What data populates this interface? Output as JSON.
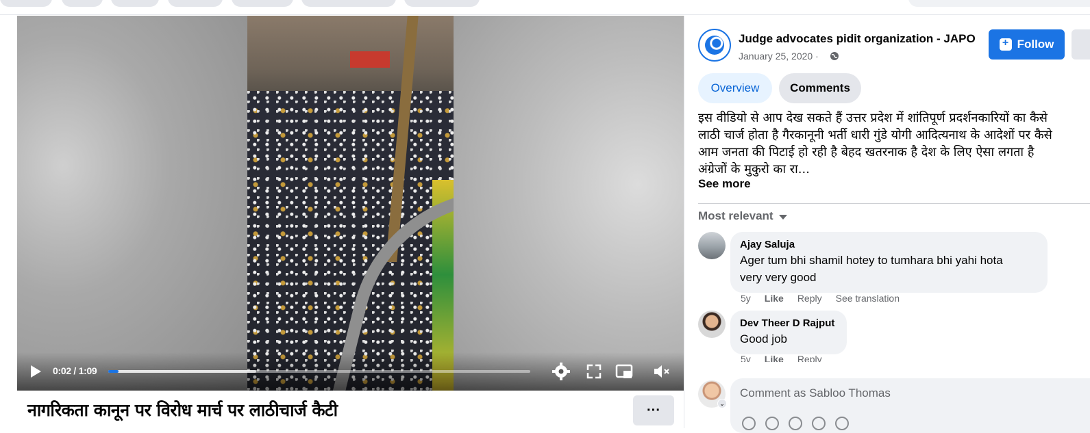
{
  "video": {
    "current_time": "0:02",
    "duration": "1:09",
    "time_display": "0:02 / 1:09",
    "progress_fraction": 0.004,
    "title": "नागरिकता कानून पर विरोध मार्च पर लाठीचार्ज कैटी"
  },
  "post": {
    "page_name": "Judge advocates pidit organization - JAPO",
    "date": "January 25, 2020 ·",
    "follow_label": "Follow",
    "tabs": [
      {
        "label": "Overview",
        "active": true
      },
      {
        "label": "Comments",
        "active": false
      }
    ],
    "description_lines": [
      "इस वीडियो से आप देख सकते हैं उत्तर प्रदेश में शांतिपूर्ण प्रदर्शनकारियों का कैसे",
      "लाठी चार्ज होता है गैरकानूनी भर्ती धारी गुंडे योगी आदित्यनाथ के आदेशों पर कैसे",
      "आम जनता की पिटाई हो रही है बेहद खतरनाक है देश के लिए ऐसा लगता है",
      "अंग्रेजों के मुकुरो का रा..."
    ],
    "see_more": "See more"
  },
  "comments_section": {
    "sort_label": "Most relevant",
    "comments": [
      {
        "author": "Ajay Saluja",
        "text_lines": [
          "Ager tum bhi shamil hotey to tumhara bhi yahi hota",
          "very very good"
        ],
        "age": "5y",
        "like": "Like",
        "reply": "Reply",
        "translate": "See translation"
      },
      {
        "author": "Dev Theer D Rajput",
        "text_lines": [
          "Good job"
        ],
        "age": "5y",
        "like": "Like",
        "reply": "Reply"
      }
    ],
    "composer_placeholder": "Comment as Sabloo Thomas"
  },
  "colors": {
    "accent": "#1b74e4",
    "tab_active_bg": "#e7f3ff",
    "bubble_bg": "#f0f2f5",
    "secondary_text": "#65676b"
  },
  "icons": [
    "play-icon",
    "settings-icon",
    "fullscreen-icon",
    "pip-icon",
    "mute-icon",
    "more-icon",
    "globe-icon",
    "follow-icon",
    "sort-caret-icon"
  ]
}
